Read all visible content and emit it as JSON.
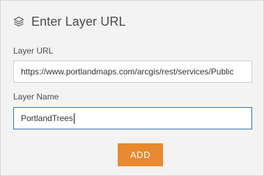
{
  "header": {
    "icon": "layers-icon",
    "title": "Enter Layer URL"
  },
  "form": {
    "url_label": "Layer URL",
    "url_value": "https://www.portlandmaps.com/arcgis/rest/services/Public",
    "name_label": "Layer Name",
    "name_value": "PortlandTrees"
  },
  "actions": {
    "add_label": "ADD"
  },
  "colors": {
    "accent": "#e8892f",
    "focus_border": "#2b6fb0",
    "panel_bg": "#f3f3f3"
  }
}
